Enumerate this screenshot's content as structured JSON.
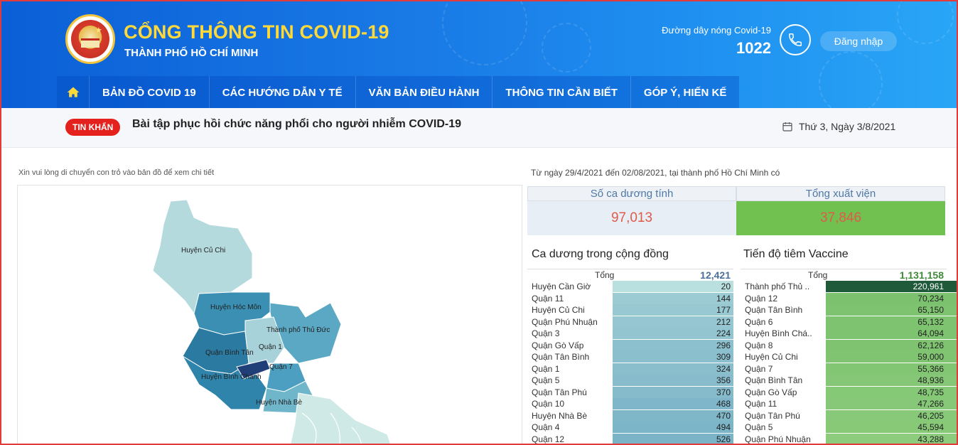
{
  "header": {
    "title": "CỔNG THÔNG TIN COVID-19",
    "subtitle": "THÀNH PHỐ HỒ CHÍ MINH",
    "hotline_label": "Đường dây nóng Covid-19",
    "hotline_number": "1022",
    "login_label": "Đăng nhập"
  },
  "nav": {
    "items": [
      {
        "label": "BẢN ĐỒ COVID 19"
      },
      {
        "label": "CÁC HƯỚNG DẪN Y TẾ"
      },
      {
        "label": "VĂN BẢN ĐIỀU HÀNH"
      },
      {
        "label": "THÔNG TIN CẦN BIẾT"
      },
      {
        "label": "GÓP Ý, HIẾN KẾ"
      }
    ]
  },
  "news": {
    "badge": "TIN KHẨN",
    "headline": "Bài tập phục hồi chức năng phổi cho người nhiễm COVID-19",
    "date": "Thứ 3, Ngày 3/8/2021"
  },
  "map": {
    "hint": "Xin vui lòng di chuyển con trỏ vào bản đồ để xem chi tiết",
    "labels": [
      "Huyện Củ Chi",
      "Huyện Hóc Môn",
      "Thành phố Thủ Đức",
      "Quận 1",
      "Quận Bình Tân",
      "Quận 7",
      "Huyện Bình Chánh",
      "Huyện Nhà Bè"
    ]
  },
  "stats": {
    "intro": "Từ ngày 29/4/2021 đến 02/08/2021, tại thành phố Hồ Chí Minh có",
    "positive_label": "Số ca dương tính",
    "positive_value": "97,013",
    "discharged_label": "Tổng xuất viện",
    "discharged_value": "37,846"
  },
  "community": {
    "title": "Ca dương trong cộng đồng",
    "total_label": "Tổng",
    "total_value": "12,421",
    "rows": [
      {
        "name": "Huyện Cần Giờ",
        "value": 20
      },
      {
        "name": "Quận 11",
        "value": 144
      },
      {
        "name": "Huyện Củ Chi",
        "value": 177
      },
      {
        "name": "Quận Phú Nhuận",
        "value": 212
      },
      {
        "name": "Quận 3",
        "value": 224
      },
      {
        "name": "Quận Gò Vấp",
        "value": 296
      },
      {
        "name": "Quận Tân Bình",
        "value": 309
      },
      {
        "name": "Quận 1",
        "value": 324
      },
      {
        "name": "Quận 5",
        "value": 356
      },
      {
        "name": "Quận Tân Phú",
        "value": 370
      },
      {
        "name": "Quận 10",
        "value": 468
      },
      {
        "name": "Huyện Nhà Bè",
        "value": 470
      },
      {
        "name": "Quận 4",
        "value": 494
      },
      {
        "name": "Quận 12",
        "value": 526
      }
    ]
  },
  "vaccine": {
    "title": "Tiến độ tiêm Vaccine",
    "total_label": "Tổng",
    "total_value": "1,131,158",
    "rows": [
      {
        "name": "Thành phố Thủ ..",
        "value": 220961
      },
      {
        "name": "Quận 12",
        "value": 70234
      },
      {
        "name": "Quận Tân Bình",
        "value": 65150
      },
      {
        "name": "Quận 6",
        "value": 65132
      },
      {
        "name": "Huyện Bình Chá..",
        "value": 64094
      },
      {
        "name": "Quận 8",
        "value": 62126
      },
      {
        "name": "Huyện Củ Chi",
        "value": 59000
      },
      {
        "name": "Quận 7",
        "value": 55366
      },
      {
        "name": "Quận Bình Tân",
        "value": 48936
      },
      {
        "name": "Quận Gò Vấp",
        "value": 48735
      },
      {
        "name": "Quận 11",
        "value": 47266
      },
      {
        "name": "Quận Tân Phú",
        "value": 46205
      },
      {
        "name": "Quận 5",
        "value": 45594
      },
      {
        "name": "Quận Phú Nhuận",
        "value": 43288
      }
    ]
  },
  "colors": {
    "accent_yellow": "#ffd83a",
    "badge_red": "#e4211c",
    "positive_red": "#e05a4a",
    "discharged_green": "#70c150",
    "community_total": "#4a6f99",
    "vaccine_total": "#3f8a3a"
  }
}
